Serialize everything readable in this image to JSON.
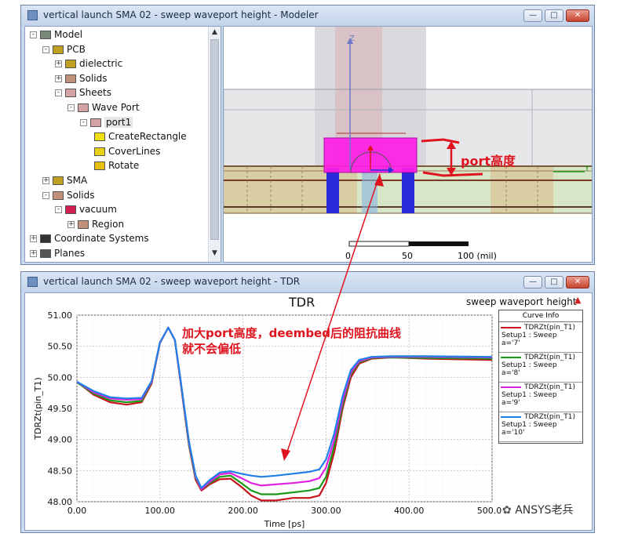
{
  "modeler": {
    "title": "vertical launch SMA 02 - sweep waveport height - Modeler",
    "tree": [
      {
        "label": "Model",
        "icon": "model-icon",
        "expander": "-"
      },
      {
        "label": "PCB",
        "icon": "group-icon",
        "expander": "-"
      },
      {
        "label": "dielectric",
        "icon": "group-icon",
        "expander": "+"
      },
      {
        "label": "Solids",
        "icon": "solid-icon",
        "expander": "+"
      },
      {
        "label": "Sheets",
        "icon": "sheet-icon",
        "expander": "-"
      },
      {
        "label": "Wave Port",
        "icon": "sheet-icon",
        "expander": "-"
      },
      {
        "label": "port1",
        "icon": "sheet-icon",
        "expander": "-"
      },
      {
        "label": "CreateRectangle",
        "icon": "create-rectangle-icon",
        "expander": ""
      },
      {
        "label": "CoverLines",
        "icon": "cover-lines-icon",
        "expander": ""
      },
      {
        "label": "Rotate",
        "icon": "rotate-icon",
        "expander": ""
      },
      {
        "label": "SMA",
        "icon": "group-icon",
        "expander": "+"
      },
      {
        "label": "Solids",
        "icon": "solid-icon",
        "expander": "-"
      },
      {
        "label": "vacuum",
        "icon": "vacuum-icon",
        "expander": "-"
      },
      {
        "label": "Region",
        "icon": "solid-icon",
        "expander": "+"
      },
      {
        "label": "Coordinate Systems",
        "icon": "coordinate-systems-icon",
        "expander": "+"
      },
      {
        "label": "Planes",
        "icon": "planes-icon",
        "expander": "+"
      }
    ],
    "viewport": {
      "axis_z": "Z",
      "axis_y": "Y",
      "scale_labels": [
        "0",
        "50",
        "100 (mil)"
      ],
      "annotation": "port高度"
    }
  },
  "tdr": {
    "title": "vertical launch SMA 02 - sweep waveport height - TDR",
    "plot_title": "TDR",
    "corner_label": "sweep waveport height",
    "annotation_line1": "加大port高度，deembed后的阻抗曲线",
    "annotation_line2": "就不会偏低",
    "legend": {
      "title": "Curve Info",
      "entries": [
        {
          "l1": "TDRZt(pin_T1)",
          "l2": "Setup1 : Sweep",
          "l3": "a='7'",
          "color": "#c8141c"
        },
        {
          "l1": "TDRZt(pin_T1)",
          "l2": "Setup1 : Sweep",
          "l3": "a='8'",
          "color": "#1a9a1a"
        },
        {
          "l1": "TDRZt(pin_T1)",
          "l2": "Setup1 : Sweep",
          "l3": "a='9'",
          "color": "#e020e0"
        },
        {
          "l1": "TDRZt(pin_T1)",
          "l2": "Setup1 : Sweep",
          "l3": "a='10'",
          "color": "#2080e8"
        }
      ]
    }
  },
  "watermark": "ANSYS老兵",
  "chart_data": {
    "type": "line",
    "title": "TDR",
    "xlabel": "Time [ps]",
    "ylabel": "TDRZt(pin_T1)",
    "xlim": [
      0,
      500
    ],
    "ylim": [
      48.0,
      51.0
    ],
    "x_ticks": [
      "0.00",
      "100.00",
      "200.00",
      "300.00",
      "400.00",
      "500.00"
    ],
    "y_ticks": [
      "51.00",
      "50.50",
      "50.00",
      "49.50",
      "49.00",
      "48.50",
      "48.00"
    ],
    "grid": true,
    "legend_position": "top-right",
    "series": [
      {
        "name": "a='7'",
        "color": "#c8141c",
        "points": [
          [
            0,
            49.93
          ],
          [
            20,
            49.72
          ],
          [
            40,
            49.6
          ],
          [
            60,
            49.56
          ],
          [
            78,
            49.6
          ],
          [
            90,
            49.9
          ],
          [
            100,
            50.55
          ],
          [
            110,
            50.8
          ],
          [
            118,
            50.6
          ],
          [
            125,
            49.9
          ],
          [
            135,
            48.9
          ],
          [
            143,
            48.35
          ],
          [
            150,
            48.18
          ],
          [
            160,
            48.28
          ],
          [
            172,
            48.36
          ],
          [
            185,
            48.37
          ],
          [
            198,
            48.24
          ],
          [
            210,
            48.1
          ],
          [
            222,
            48.02
          ],
          [
            240,
            48.02
          ],
          [
            260,
            48.06
          ],
          [
            280,
            48.06
          ],
          [
            292,
            48.1
          ],
          [
            300,
            48.3
          ],
          [
            310,
            48.8
          ],
          [
            320,
            49.5
          ],
          [
            330,
            50.0
          ],
          [
            340,
            50.22
          ],
          [
            355,
            50.3
          ],
          [
            380,
            50.32
          ],
          [
            420,
            50.3
          ],
          [
            500,
            50.28
          ]
        ]
      },
      {
        "name": "a='8'",
        "color": "#1a9a1a",
        "points": [
          [
            0,
            49.92
          ],
          [
            20,
            49.74
          ],
          [
            40,
            49.63
          ],
          [
            60,
            49.6
          ],
          [
            78,
            49.62
          ],
          [
            90,
            49.92
          ],
          [
            100,
            50.56
          ],
          [
            110,
            50.8
          ],
          [
            118,
            50.6
          ],
          [
            125,
            49.92
          ],
          [
            135,
            48.92
          ],
          [
            143,
            48.38
          ],
          [
            150,
            48.2
          ],
          [
            160,
            48.3
          ],
          [
            172,
            48.4
          ],
          [
            185,
            48.42
          ],
          [
            198,
            48.3
          ],
          [
            210,
            48.18
          ],
          [
            222,
            48.12
          ],
          [
            240,
            48.12
          ],
          [
            260,
            48.15
          ],
          [
            280,
            48.18
          ],
          [
            292,
            48.22
          ],
          [
            300,
            48.4
          ],
          [
            310,
            48.9
          ],
          [
            320,
            49.55
          ],
          [
            330,
            50.05
          ],
          [
            340,
            50.24
          ],
          [
            355,
            50.31
          ],
          [
            380,
            50.32
          ],
          [
            420,
            50.31
          ],
          [
            500,
            50.3
          ]
        ]
      },
      {
        "name": "a='9'",
        "color": "#e020e0",
        "points": [
          [
            0,
            49.93
          ],
          [
            20,
            49.76
          ],
          [
            40,
            49.66
          ],
          [
            60,
            49.64
          ],
          [
            78,
            49.65
          ],
          [
            90,
            49.93
          ],
          [
            100,
            50.56
          ],
          [
            110,
            50.8
          ],
          [
            118,
            50.6
          ],
          [
            125,
            49.93
          ],
          [
            135,
            48.95
          ],
          [
            143,
            48.4
          ],
          [
            150,
            48.2
          ],
          [
            160,
            48.32
          ],
          [
            172,
            48.44
          ],
          [
            185,
            48.46
          ],
          [
            198,
            48.38
          ],
          [
            210,
            48.3
          ],
          [
            222,
            48.26
          ],
          [
            240,
            48.28
          ],
          [
            260,
            48.3
          ],
          [
            280,
            48.33
          ],
          [
            292,
            48.38
          ],
          [
            300,
            48.55
          ],
          [
            310,
            49.0
          ],
          [
            320,
            49.62
          ],
          [
            330,
            50.08
          ],
          [
            340,
            50.26
          ],
          [
            355,
            50.32
          ],
          [
            380,
            50.33
          ],
          [
            420,
            50.33
          ],
          [
            500,
            50.32
          ]
        ]
      },
      {
        "name": "a='10'",
        "color": "#2080e8",
        "points": [
          [
            0,
            49.93
          ],
          [
            20,
            49.78
          ],
          [
            40,
            49.68
          ],
          [
            60,
            49.66
          ],
          [
            78,
            49.67
          ],
          [
            90,
            49.94
          ],
          [
            100,
            50.56
          ],
          [
            110,
            50.8
          ],
          [
            118,
            50.6
          ],
          [
            125,
            49.94
          ],
          [
            135,
            48.97
          ],
          [
            143,
            48.42
          ],
          [
            150,
            48.22
          ],
          [
            160,
            48.35
          ],
          [
            172,
            48.47
          ],
          [
            185,
            48.49
          ],
          [
            198,
            48.45
          ],
          [
            210,
            48.42
          ],
          [
            222,
            48.4
          ],
          [
            240,
            48.42
          ],
          [
            260,
            48.45
          ],
          [
            280,
            48.48
          ],
          [
            292,
            48.52
          ],
          [
            300,
            48.68
          ],
          [
            310,
            49.1
          ],
          [
            320,
            49.7
          ],
          [
            330,
            50.12
          ],
          [
            340,
            50.28
          ],
          [
            355,
            50.33
          ],
          [
            380,
            50.34
          ],
          [
            420,
            50.34
          ],
          [
            500,
            50.33
          ]
        ]
      }
    ]
  }
}
